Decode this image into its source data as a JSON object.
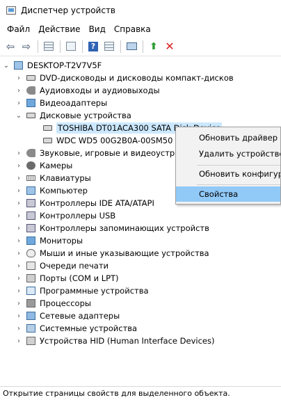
{
  "window": {
    "title": "Диспетчер устройств"
  },
  "menubar": {
    "items": [
      "Файл",
      "Действие",
      "Вид",
      "Справка"
    ]
  },
  "toolbar": {
    "buttons": [
      "back-arrow-icon",
      "forward-arrow-icon",
      "properties-sheet-icon",
      "sheet-icon",
      "help-icon",
      "view-sheet-icon",
      "monitor-icon",
      "update-driver-icon",
      "delete-icon"
    ]
  },
  "tree": {
    "root": "DESKTOP-T2V7V5F",
    "categories": [
      "DVD-дисководы и дисководы компакт-дисков",
      "Аудиовходы и аудиовыходы",
      "Видеоадаптеры",
      "Дисковые устройства",
      "Звуковые, игровые и видеоустрой",
      "Камеры",
      "Клавиатуры",
      "Компьютер",
      "Контроллеры IDE ATA/ATAPI",
      "Контроллеры USB",
      "Контроллеры запоминающих устройств",
      "Мониторы",
      "Мыши и иные указывающие устройства",
      "Очереди печати",
      "Порты (COM и LPT)",
      "Программные устройства",
      "Процессоры",
      "Сетевые адаптеры",
      "Системные устройства",
      "Устройства HID (Human Interface Devices)"
    ],
    "disk_children": [
      "TOSHIBA DT01ACA300 SATA Disk Device",
      "WDC WD5 00G2B0A-00SM50 S"
    ]
  },
  "context_menu": {
    "items": [
      "Обновить драйвер",
      "Удалить устройство",
      "Обновить конфигура",
      "Свойства"
    ]
  },
  "status": {
    "text": "Открытие страницы свойств для выделенного объекта."
  },
  "colors": {
    "selection": "#cce8ff",
    "menu_hover": "#91c9f7"
  }
}
